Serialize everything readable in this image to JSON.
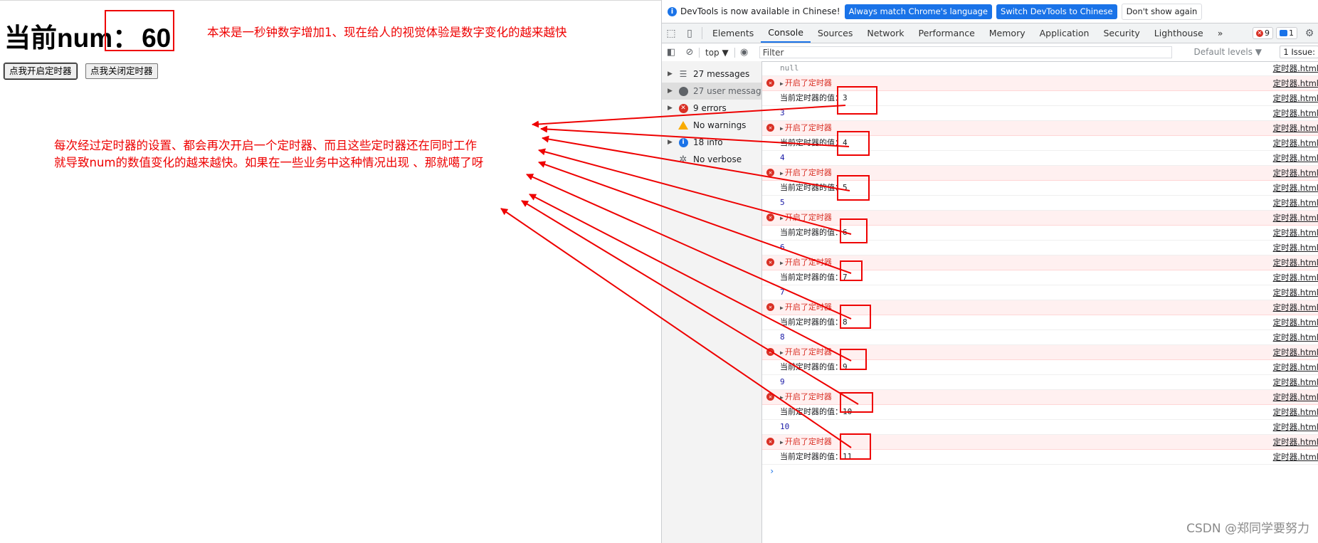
{
  "page": {
    "heading_label": "当前num：",
    "num_value": "60",
    "annotation_top": "本来是一秒钟数字增加1、现在给人的视觉体验是数字变化的越来越快",
    "annotation_line1": "每次经过定时器的设置、都会再次开启一个定时器、而且这些定时器还在同时工作",
    "annotation_line2": "就导致num的数值变化的越来越快。如果在一些业务中这种情况出现 、那就噶了呀",
    "btn_start": "点我开启定时器",
    "btn_stop": "点我关闭定时器",
    "annotation_color": "#ee0000"
  },
  "devtools": {
    "infobar": {
      "message": "DevTools is now available in Chinese!",
      "btn_match": "Always match Chrome's language",
      "btn_switch": "Switch DevTools to Chinese",
      "btn_dismiss": "Don't show again"
    },
    "tabs": [
      "Elements",
      "Console",
      "Sources",
      "Network",
      "Performance",
      "Memory",
      "Application",
      "Security",
      "Lighthouse"
    ],
    "more_tabs": "»",
    "error_count": "9",
    "message_count": "1",
    "toolbar": {
      "context": "top ▼",
      "filter_placeholder": "Filter",
      "levels": "Default levels ▼",
      "issues": "1 Issue:"
    },
    "sidebar": [
      {
        "label": "27 messages",
        "icon": "list-icon"
      },
      {
        "label": "27 user messag...",
        "icon": "user-icon"
      },
      {
        "label": "9 errors",
        "icon": "error-icon"
      },
      {
        "label": "No warnings",
        "icon": "warning-icon"
      },
      {
        "label": "18 info",
        "icon": "info-icon"
      },
      {
        "label": "No verbose",
        "icon": "verbose-icon"
      }
    ],
    "log_source": "定时器.html",
    "log_null": "null",
    "log_error_text": "开启了定时器",
    "log_value_prefix": "当前定时器的值：",
    "log_values": [
      "3",
      "4",
      "5",
      "6",
      "7",
      "8",
      "9",
      "10",
      "11"
    ],
    "brand_blue": "#1a73e8",
    "error_red": "#d93025"
  },
  "watermark": "CSDN @郑同学要努力"
}
